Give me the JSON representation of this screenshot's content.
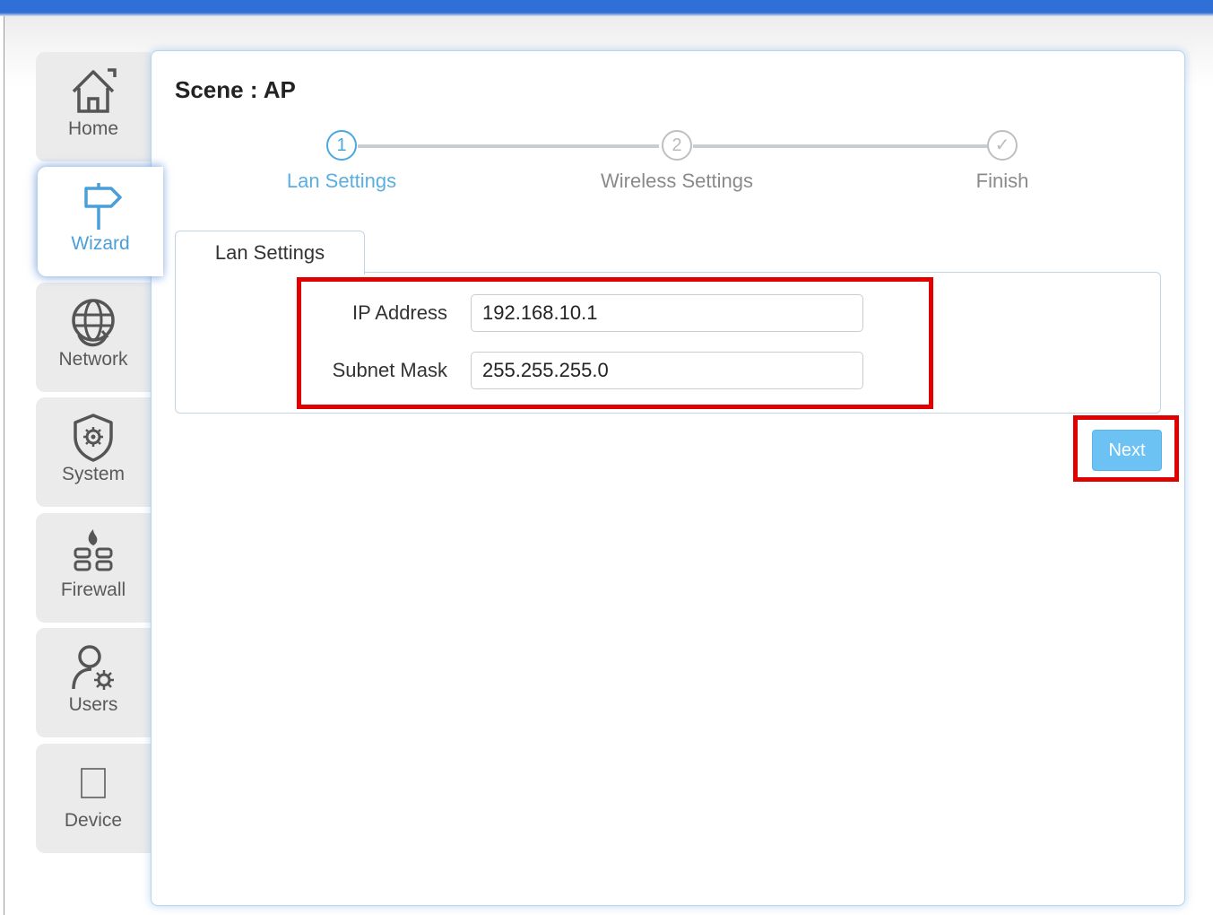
{
  "sidebar": {
    "items": [
      {
        "label": "Home",
        "icon": "home-icon"
      },
      {
        "label": "Wizard",
        "icon": "signpost-icon",
        "active": true
      },
      {
        "label": "Network",
        "icon": "globe-sync-icon"
      },
      {
        "label": "System",
        "icon": "shield-gear-icon"
      },
      {
        "label": "Firewall",
        "icon": "firewall-icon"
      },
      {
        "label": "Users",
        "icon": "user-gear-icon"
      },
      {
        "label": "Device",
        "icon": "device-icon"
      }
    ]
  },
  "main": {
    "title": "Scene : AP",
    "steps": [
      {
        "number": "1",
        "label": "Lan Settings",
        "state": "active"
      },
      {
        "number": "2",
        "label": "Wireless Settings",
        "state": "pending"
      },
      {
        "number": "✓",
        "label": "Finish",
        "state": "pending"
      }
    ],
    "tab_label": "Lan Settings",
    "fields": {
      "ip_label": "IP Address",
      "ip_value": "192.168.10.1",
      "mask_label": "Subnet Mask",
      "mask_value": "255.255.255.0"
    },
    "next_label": "Next"
  },
  "colors": {
    "accent": "#4aa8e0",
    "button": "#6cc3f3",
    "highlight": "#e00000",
    "top_bar": "#2f6fd6"
  }
}
